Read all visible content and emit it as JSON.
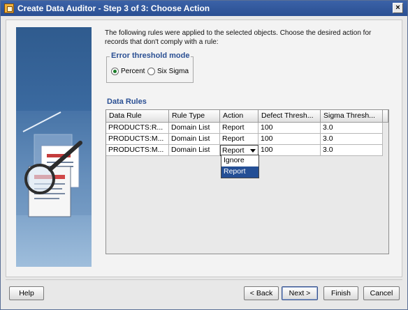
{
  "window": {
    "title": "Create Data Auditor - Step 3 of 3: Choose Action",
    "close_glyph": "×"
  },
  "intro": {
    "text": "The following rules were applied to the selected objects. Choose the desired action for records that don't comply with a rule:"
  },
  "error_threshold": {
    "title": "Error threshold mode",
    "options": [
      {
        "label": "Percent",
        "selected": true
      },
      {
        "label": "Six Sigma",
        "selected": false
      }
    ]
  },
  "data_rules": {
    "title": "Data Rules",
    "columns": [
      "Data Rule",
      "Rule Type",
      "Action",
      "Defect Thresh...",
      "Sigma Thresh..."
    ],
    "rows": [
      [
        "PRODUCTS:R...",
        "Domain List",
        "Report",
        "100",
        "3.0"
      ],
      [
        "PRODUCTS:M...",
        "Domain List",
        "Report",
        "100",
        "3.0"
      ],
      [
        "PRODUCTS:M...",
        "Domain List",
        "Report",
        "100",
        "3.0"
      ]
    ],
    "action_options": [
      "Ignore",
      "Report"
    ],
    "action_selected": "Report"
  },
  "buttons": {
    "help": "Help",
    "back": "< Back",
    "next": "Next >",
    "finish": "Finish",
    "cancel": "Cancel"
  },
  "icons": {
    "app": "data-auditor-app-icon",
    "close": "close-icon",
    "illustration": "magnifier-document-illustration",
    "caret": "chevron-down-icon"
  },
  "colors": {
    "titlebar": "#2a4f93",
    "accent_text": "#2a4f93",
    "selection": "#244f95"
  }
}
